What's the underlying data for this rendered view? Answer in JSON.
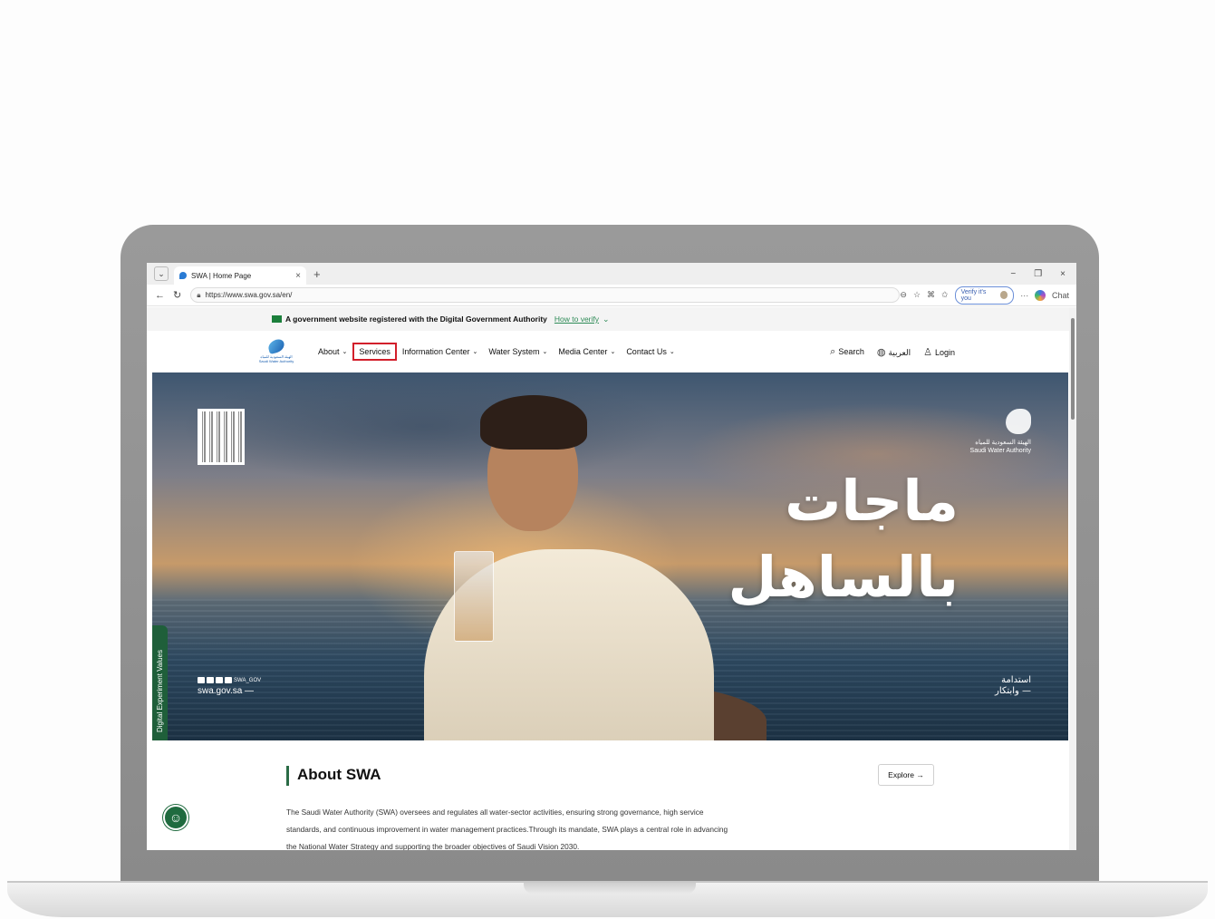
{
  "browser": {
    "tab_title": "SWA | Home Page",
    "tab_close": "×",
    "new_tab": "+",
    "url": "https://www.swa.gov.sa/en/",
    "verify_label": "Verify it's you",
    "chat_label": "Chat",
    "more": "···",
    "window_controls": {
      "minimize": "−",
      "restore": "❐",
      "close": "×"
    }
  },
  "gov_banner": {
    "text": "A government website registered with the Digital Government Authority",
    "link": "How to verify"
  },
  "header": {
    "logo_text": "الهيئة السعودية للمياه Saudi Water Authority",
    "nav": {
      "about": "About",
      "services": "Services",
      "information_center": "Information Center",
      "water_system": "Water System",
      "media_center": "Media Center",
      "contact_us": "Contact Us"
    },
    "search": "Search",
    "language": "العربية",
    "login": "Login"
  },
  "hero": {
    "headline_line1": "ماجات",
    "headline_line2": "بالساهل",
    "authority_ar": "الهيئة السعودية للمياه",
    "authority_en": "Saudi Water Authority",
    "social_handle": "SWA_GOV",
    "site": "swa.gov.sa —",
    "tagline_line1": "استدامة",
    "tagline_line2": "— وابتكار"
  },
  "side_tab": "Digital Experiment Values",
  "about": {
    "title": "About SWA",
    "explore": "Explore →",
    "body": "The Saudi Water Authority (SWA) oversees and regulates all water-sector activities, ensuring strong governance, high service standards, and continuous improvement in water management practices.Through its mandate, SWA plays a central role in advancing the National Water Strategy and supporting the broader objectives of Saudi Vision 2030."
  },
  "colors": {
    "highlight": "#d21f2b",
    "brand_green": "#1f6b3f",
    "link_green": "#2e8b57"
  },
  "icons": [
    "back-icon",
    "refresh-icon",
    "lock-icon",
    "search-icon",
    "globe-icon",
    "user-icon",
    "accessibility-icon",
    "qr-code-icon",
    "chevron-down-icon"
  ]
}
